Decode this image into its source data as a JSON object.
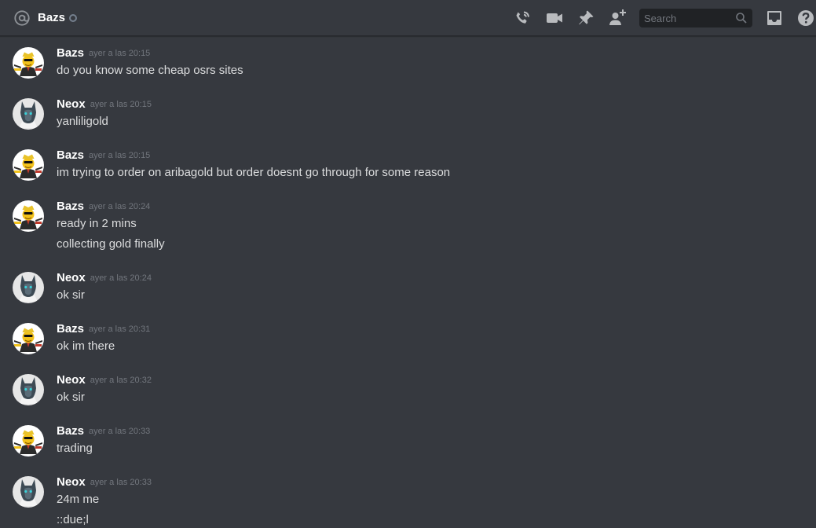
{
  "header": {
    "title": "Bazs",
    "search_placeholder": "Search",
    "icons": [
      "at-icon",
      "call-icon",
      "video-icon",
      "pin-icon",
      "add-friend-icon",
      "search-icon",
      "inbox-icon",
      "help-icon"
    ]
  },
  "colors": {
    "background": "#36393f",
    "search_bg": "#202225",
    "timestamp": "#72767d",
    "text": "#dcddde"
  },
  "messages": [
    {
      "author": "Bazs",
      "timestamp": "ayer a las 20:15",
      "lines": [
        "do you know some cheap osrs sites"
      ]
    },
    {
      "author": "Neox",
      "timestamp": "ayer a las 20:15",
      "lines": [
        "yanliligold"
      ]
    },
    {
      "author": "Bazs",
      "timestamp": "ayer a las 20:15",
      "lines": [
        "im trying to order on aribagold but order doesnt go through for some reason"
      ]
    },
    {
      "author": "Bazs",
      "timestamp": "ayer a las 20:24",
      "lines": [
        "ready in 2 mins",
        "collecting gold finally"
      ]
    },
    {
      "author": "Neox",
      "timestamp": "ayer a las 20:24",
      "lines": [
        "ok sir"
      ]
    },
    {
      "author": "Bazs",
      "timestamp": "ayer a las 20:31",
      "lines": [
        "ok im there"
      ]
    },
    {
      "author": "Neox",
      "timestamp": "ayer a las 20:32",
      "lines": [
        "ok sir"
      ]
    },
    {
      "author": "Bazs",
      "timestamp": "ayer a las 20:33",
      "lines": [
        "trading"
      ]
    },
    {
      "author": "Neox",
      "timestamp": "ayer a las 20:33",
      "lines": [
        "24m me",
        "::due;l"
      ]
    }
  ]
}
